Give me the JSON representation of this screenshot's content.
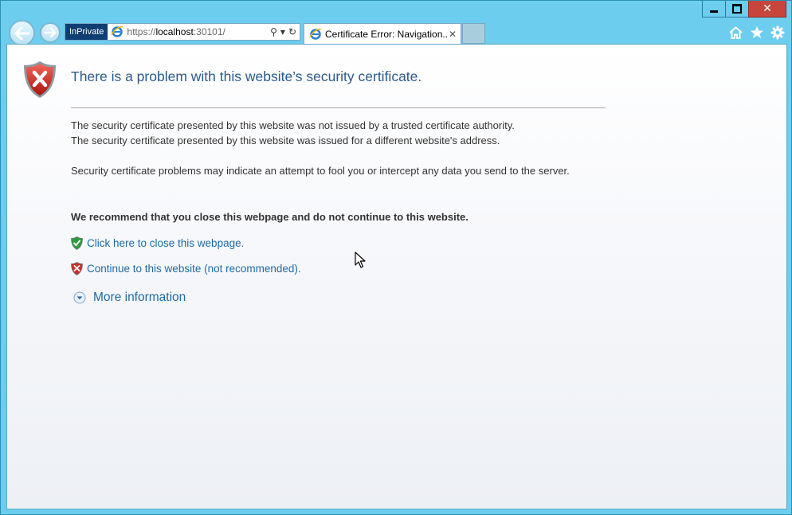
{
  "window": {
    "buttons": {
      "close": "✕"
    }
  },
  "toolbar": {
    "inprivate_label": "InPrivate",
    "url_prefix": "https://",
    "url_host": "localhost",
    "url_suffix": ":30101/",
    "search_glyph": "⚲",
    "dropdown_glyph": "▾",
    "refresh_glyph": "↻"
  },
  "tabs": [
    {
      "title": "Certificate Error: Navigation...",
      "close": "✕"
    }
  ],
  "page": {
    "heading": "There is a problem with this website’s security certificate.",
    "paragraph1_line1": "The security certificate presented by this website was not issued by a trusted certificate authority.",
    "paragraph1_line2": "The security certificate presented by this website was issued for a different website's address.",
    "paragraph2": "Security certificate problems may indicate an attempt to fool you or intercept any data you send to the server.",
    "recommendation": "We recommend that you close this webpage and do not continue to this website.",
    "close_link": "Click here to close this webpage.",
    "continue_link": "Continue to this website (not recommended).",
    "more_info": "More information"
  },
  "icons": {
    "error_shield": "shield-error-icon",
    "safe_shield": "shield-check-icon",
    "warn_shield": "shield-x-icon",
    "expand": "chevron-down-circle-icon"
  },
  "colors": {
    "frame": "#6ccdee",
    "heading": "#2a5a8c",
    "link": "#1f6aa5",
    "inprivate": "#0f3e73",
    "close_button": "#c7463b"
  }
}
